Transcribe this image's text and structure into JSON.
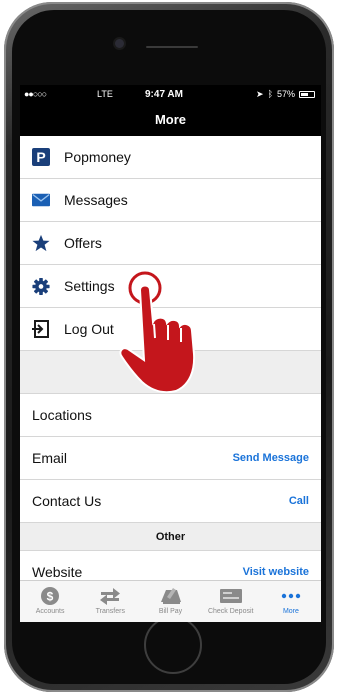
{
  "status_bar": {
    "signal": "●●○○○",
    "carrier": "LTE",
    "time": "9:47 AM",
    "battery": "57%",
    "battery_level": 0.57
  },
  "nav": {
    "title": "More"
  },
  "menu_items": [
    {
      "label": "Popmoney",
      "icon": "popmoney-icon"
    },
    {
      "label": "Messages",
      "icon": "envelope-icon"
    },
    {
      "label": "Offers",
      "icon": "star-icon"
    },
    {
      "label": "Settings",
      "icon": "gear-icon"
    },
    {
      "label": "Log Out",
      "icon": "logout-icon"
    }
  ],
  "info_rows": [
    {
      "label": "Locations",
      "action": ""
    },
    {
      "label": "Email",
      "action": "Send Message"
    },
    {
      "label": "Contact Us",
      "action": "Call"
    }
  ],
  "other_section": {
    "header": "Other",
    "rows": [
      {
        "label": "Website",
        "action": "Visit website"
      }
    ]
  },
  "tabs": [
    {
      "label": "Accounts",
      "icon": "dollar-circle-icon",
      "active": false
    },
    {
      "label": "Transfers",
      "icon": "transfer-arrows-icon",
      "active": false
    },
    {
      "label": "Bill Pay",
      "icon": "bill-pay-icon",
      "active": false
    },
    {
      "label": "Check Deposit",
      "icon": "check-icon",
      "active": false
    },
    {
      "label": "More",
      "icon": "more-dots-icon",
      "active": true
    }
  ],
  "colors": {
    "accent": "#1a73d9",
    "brand_dark": "#1a3f7a",
    "hand": "#c4161c"
  }
}
